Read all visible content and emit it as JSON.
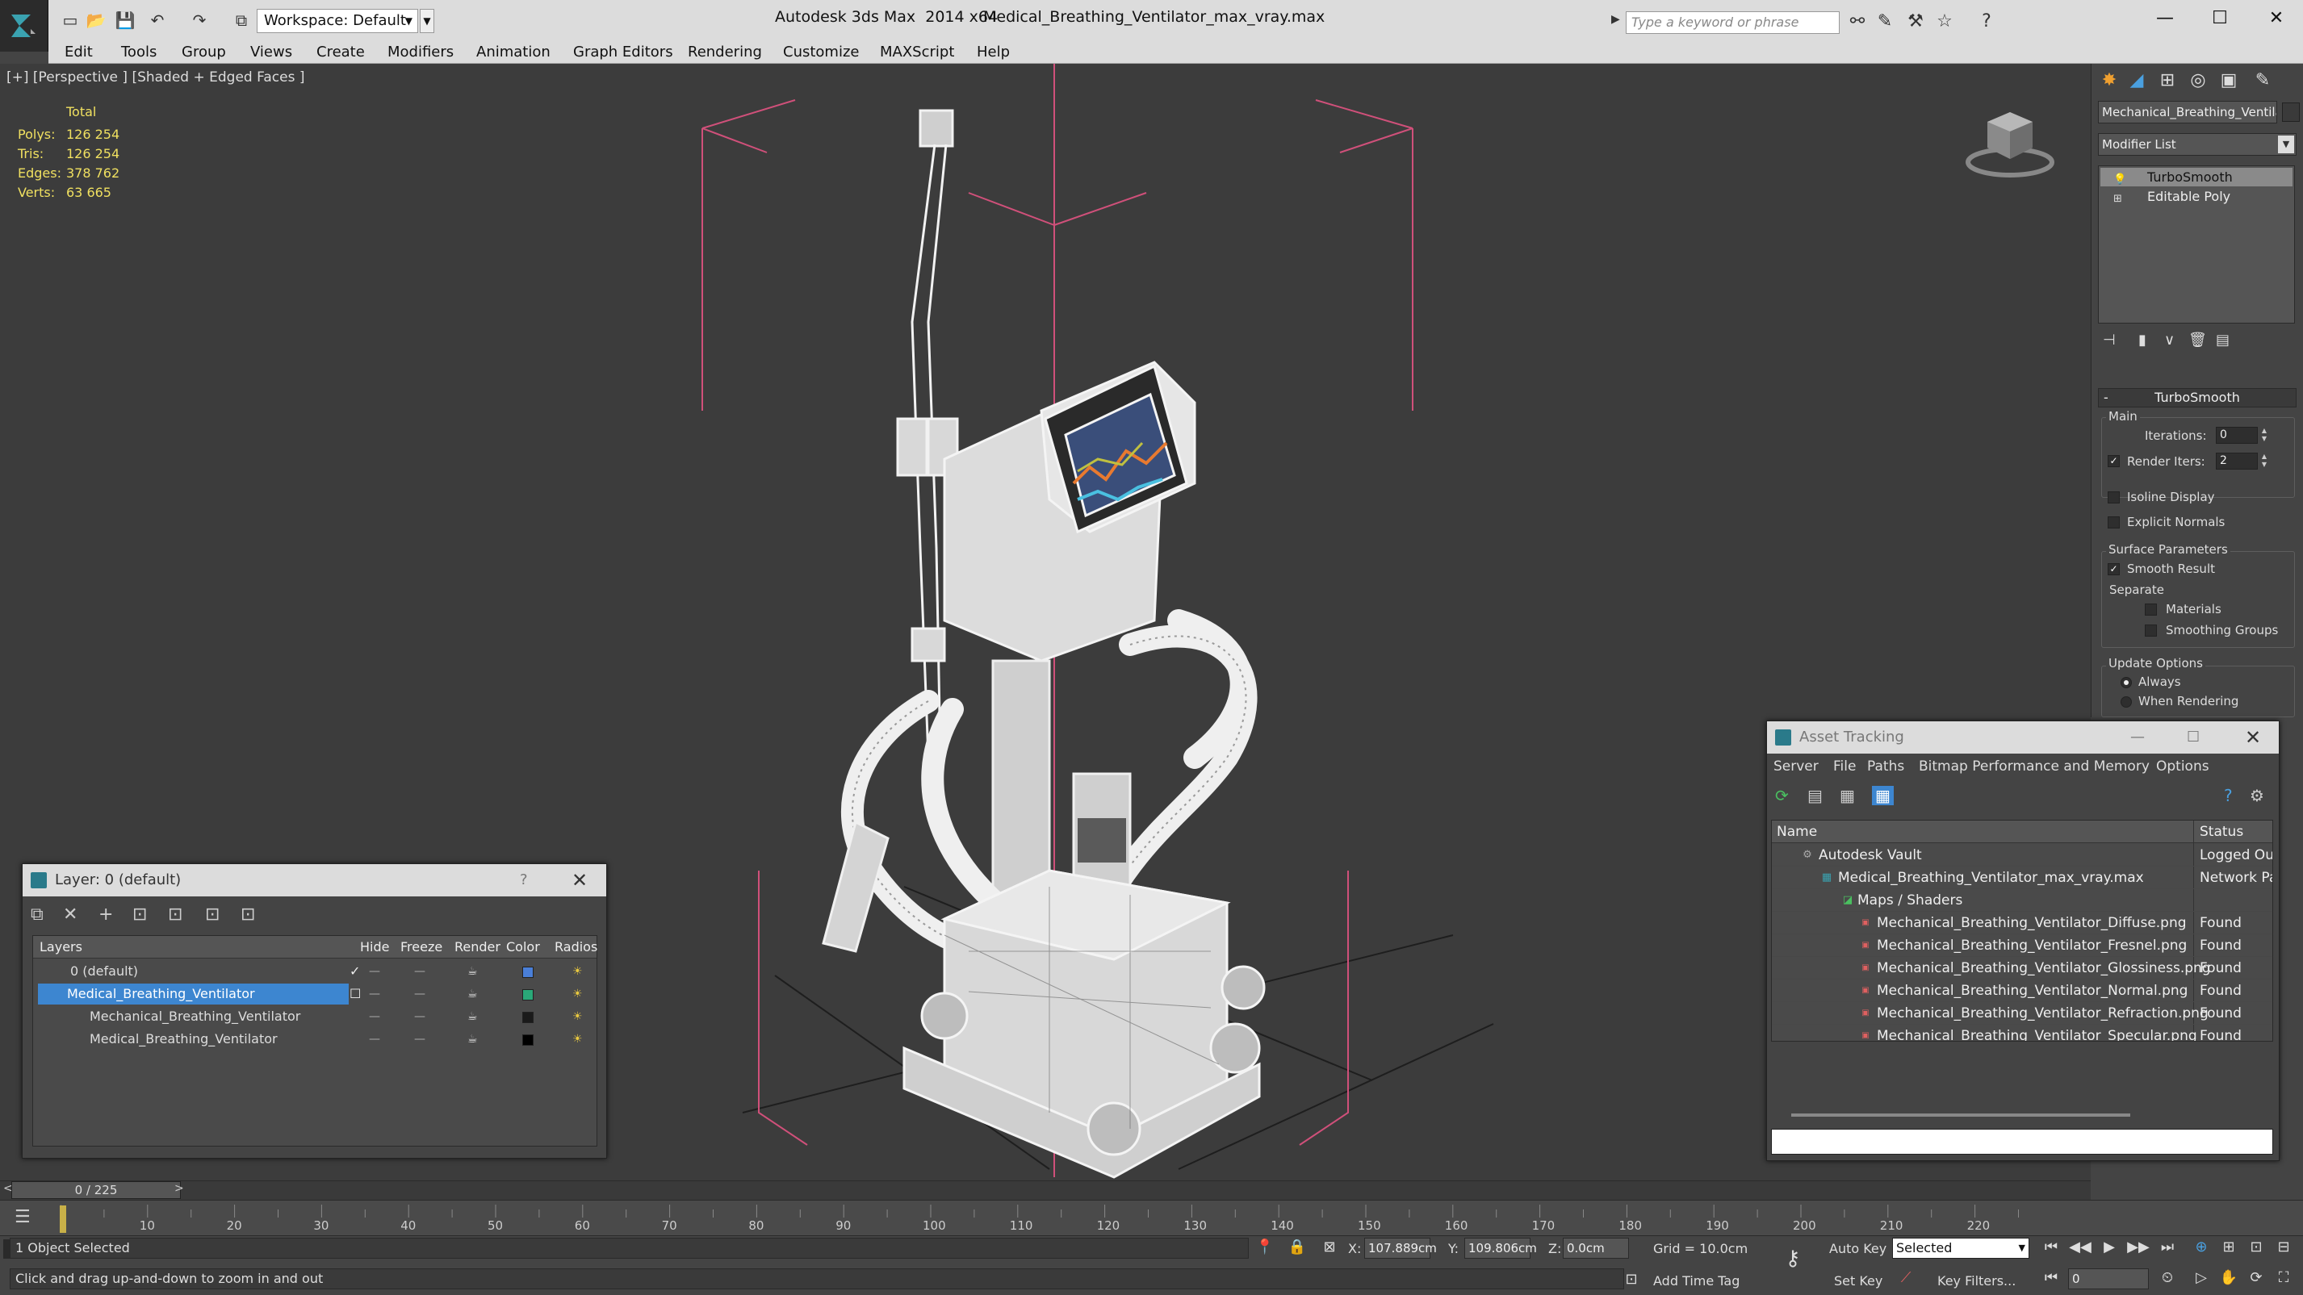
{
  "app": {
    "title": "Autodesk 3ds Max  2014 x64",
    "file": "Medical_Breathing_Ventilator_max_vray.max",
    "workspace": "Workspace: Default",
    "search_placeholder": "Type a keyword or phrase"
  },
  "menubar": [
    "Edit",
    "Tools",
    "Group",
    "Views",
    "Create",
    "Modifiers",
    "Animation",
    "Graph Editors",
    "Rendering",
    "Customize",
    "MAXScript",
    "Help"
  ],
  "viewport": {
    "label": "[+] [Perspective ] [Shaded + Edged Faces ]",
    "stats": {
      "header": "Total",
      "rows": [
        {
          "label": "Polys:",
          "value": "126 254"
        },
        {
          "label": "Tris:",
          "value": "126 254"
        },
        {
          "label": "Edges:",
          "value": "378 762"
        },
        {
          "label": "Verts:",
          "value": "63 665"
        }
      ]
    }
  },
  "command_panel": {
    "object_name": "Mechanical_Breathing_Ventilator",
    "modifier_list": "Modifier List",
    "stack": [
      "TurboSmooth",
      "Editable Poly"
    ],
    "rollout_title": "TurboSmooth",
    "main_label": "Main",
    "iterations_label": "Iterations:",
    "iterations_value": "0",
    "render_iters_label": "Render Iters:",
    "render_iters_value": "2",
    "isoline_label": "Isoline Display",
    "explicit_normals_label": "Explicit Normals",
    "surface_params_label": "Surface Parameters",
    "smooth_result_label": "Smooth Result",
    "separate_label": "Separate",
    "materials_label": "Materials",
    "smoothing_groups_label": "Smoothing Groups",
    "update_options_label": "Update Options",
    "always_label": "Always",
    "when_rendering_label": "When Rendering"
  },
  "layer_window": {
    "title": "Layer: 0 (default)",
    "help": "?",
    "columns": [
      "Layers",
      "Hide",
      "Freeze",
      "Render",
      "Color",
      "Radios"
    ],
    "rows": [
      {
        "name": "0 (default)",
        "color": "#4a7fd8"
      },
      {
        "name": "Medical_Breathing_Ventilator",
        "color": "#2aa878"
      },
      {
        "name": "Mechanical_Breathing_Ventilator",
        "color": "#1a1a1a"
      },
      {
        "name": "Medical_Breathing_Ventilator",
        "color": "#000000"
      }
    ]
  },
  "asset_tracking": {
    "title": "Asset Tracking",
    "menu": [
      "Server",
      "File",
      "Paths",
      "Bitmap Performance and Memory",
      "Options"
    ],
    "columns": [
      "Name",
      "Status"
    ],
    "rows": [
      {
        "name": "Autodesk Vault",
        "status": "Logged Out"
      },
      {
        "name": "Medical_Breathing_Ventilator_max_vray.max",
        "status": "Network Pa"
      },
      {
        "name": "Maps / Shaders",
        "status": ""
      },
      {
        "name": "Mechanical_Breathing_Ventilator_Diffuse.png",
        "status": "Found"
      },
      {
        "name": "Mechanical_Breathing_Ventilator_Fresnel.png",
        "status": "Found"
      },
      {
        "name": "Mechanical_Breathing_Ventilator_Glossiness.png",
        "status": "Found"
      },
      {
        "name": "Mechanical_Breathing_Ventilator_Normal.png",
        "status": "Found"
      },
      {
        "name": "Mechanical_Breathing_Ventilator_Refraction.png",
        "status": "Found"
      },
      {
        "name": "Mechanical_Breathing_Ventilator_Specular.png",
        "status": "Found"
      }
    ]
  },
  "timeline": {
    "frame_display": "0 / 225",
    "ticks": [
      "10",
      "20",
      "30",
      "40",
      "50",
      "60",
      "70",
      "80",
      "90",
      "100",
      "110",
      "120",
      "130",
      "140",
      "150",
      "160",
      "170",
      "180",
      "190",
      "200",
      "210",
      "220"
    ]
  },
  "statusbar": {
    "selection": "1 Object Selected",
    "prompt": "Click and drag up-and-down to zoom in and out",
    "x_label": "X:",
    "x_value": "107.889cm",
    "y_label": "Y:",
    "y_value": "109.806cm",
    "z_label": "Z:",
    "z_value": "0.0cm",
    "grid": "Grid = 10.0cm",
    "auto_key": "Auto Key",
    "selected": "Selected",
    "set_key": "Set Key",
    "key_filters": "Key Filters...",
    "add_time_tag": "Add Time Tag",
    "frame_value": "0"
  }
}
